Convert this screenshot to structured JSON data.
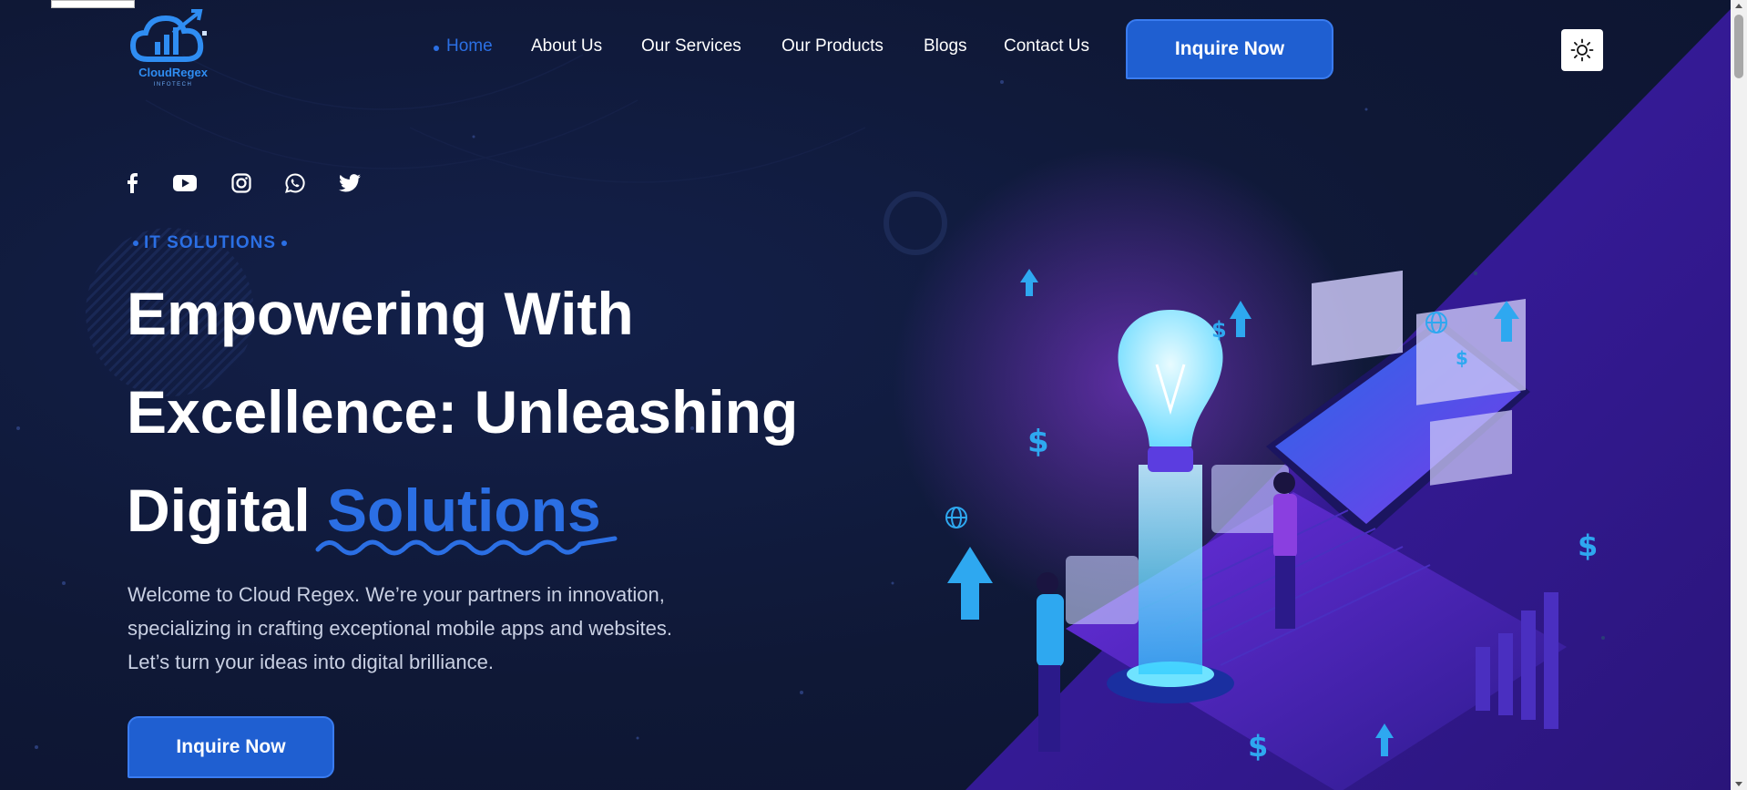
{
  "brand": {
    "name": "CloudRegex",
    "tagline": "INFOTECH",
    "accent": "#2b6fe4"
  },
  "nav": {
    "items": [
      {
        "label": "Home",
        "active": true
      },
      {
        "label": "About Us"
      },
      {
        "label": "Our Services"
      },
      {
        "label": "Our Products"
      },
      {
        "label": "Blogs"
      },
      {
        "label": "Contact Us"
      }
    ],
    "cta_label": "Inquire Now",
    "theme_toggle_icon": "sun-icon"
  },
  "social": [
    "facebook-icon",
    "youtube-icon",
    "instagram-icon",
    "whatsapp-icon",
    "twitter-icon"
  ],
  "hero": {
    "eyebrow": "IT SOLUTIONS",
    "headline_line1": "Empowering With",
    "headline_line2": "Excellence: Unleashing",
    "headline_line3_plain": "Digital ",
    "headline_line3_accent": "Solutions",
    "intro_line1": "Welcome to Cloud Regex. We’re your partners in innovation,",
    "intro_line2": "specializing in crafting exceptional mobile apps and websites.",
    "intro_line3": "Let’s turn your ideas into digital brilliance.",
    "cta_label": "Inquire Now"
  },
  "colors": {
    "background": "#0f1836",
    "accent": "#2b6fe4",
    "purple": "#3a1f9c",
    "button": "#1f5fd1"
  }
}
